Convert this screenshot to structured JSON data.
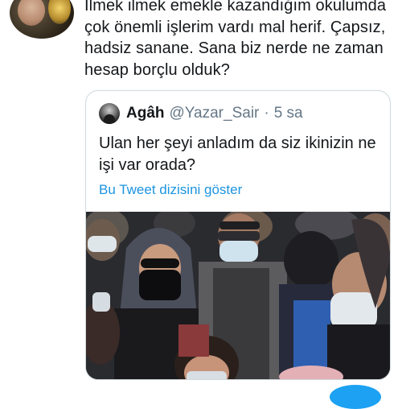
{
  "tweet": {
    "text": "İlmek ilmek emekle kazandığım okulumda çok önemli işlerim vardı mal herif. Çapsız, hadsiz sanane. Sana biz nerde ne zaman hesap borçlu olduk?"
  },
  "quoted_tweet": {
    "name": "Agâh",
    "handle": "@Yazar_Sair",
    "separator": "·",
    "time": "5 sa",
    "text": "Ulan her şeyi anladım da siz ikinizin ne işi var orada?",
    "show_thread_label": "Bu Tweet dizisini göster"
  },
  "colors": {
    "link": "#1b95e0",
    "secondary_text": "#657786",
    "card_border": "#cfd9de",
    "accent": "#1da1f2"
  }
}
